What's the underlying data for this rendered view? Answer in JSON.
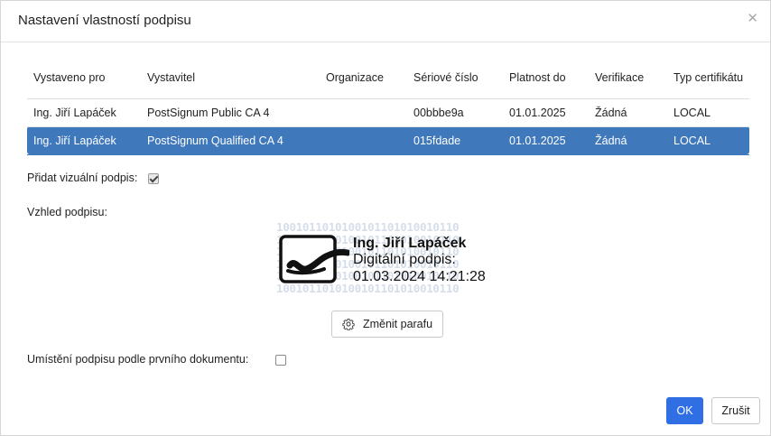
{
  "dialog": {
    "title": "Nastavení vlastností podpisu",
    "close_icon": "close-icon"
  },
  "table": {
    "headers": {
      "issued_to": "Vystaveno pro",
      "issuer": "Vystavitel",
      "organization": "Organizace",
      "serial": "Sériové číslo",
      "valid_until": "Platnost do",
      "verification": "Verifikace",
      "cert_type": "Typ certifikátu"
    },
    "rows": [
      {
        "issued_to": "Ing. Jiří Lapáček",
        "issuer": "PostSignum Public CA 4",
        "organization": "",
        "serial": "00bbbe9a",
        "valid_until": "01.01.2025",
        "verification": "Žádná",
        "cert_type": "LOCAL",
        "selected": false
      },
      {
        "issued_to": "Ing. Jiří Lapáček",
        "issuer": "PostSignum Qualified CA 4",
        "organization": "",
        "serial": "015fdade",
        "valid_until": "01.01.2025",
        "verification": "Žádná",
        "cert_type": "LOCAL",
        "selected": true
      }
    ],
    "selected_color": "#3f78bb"
  },
  "visual_signature": {
    "label": "Přidat vizuální podpis:",
    "checked": true
  },
  "appearance": {
    "label": "Vzhled podpisu:",
    "name": "Ing. Jiří Lapáček",
    "line2": "Digitální podpis:",
    "line3": "01.03.2024 14:21:28",
    "binary_pattern": [
      "1001011010100101101010010110",
      "1001011010100101101010010110",
      "1001011010100101101010010110",
      "1001011010100101101010010110",
      "1001011010100101101010010110",
      "1001011010100101101010010110"
    ],
    "change_button": "Změnit parafu",
    "change_icon": "gear-icon"
  },
  "placement": {
    "label": "Umístění podpisu podle prvního dokumentu:",
    "checked": false
  },
  "footer": {
    "ok": "OK",
    "cancel": "Zrušit",
    "ok_color": "#2f6fe3"
  }
}
